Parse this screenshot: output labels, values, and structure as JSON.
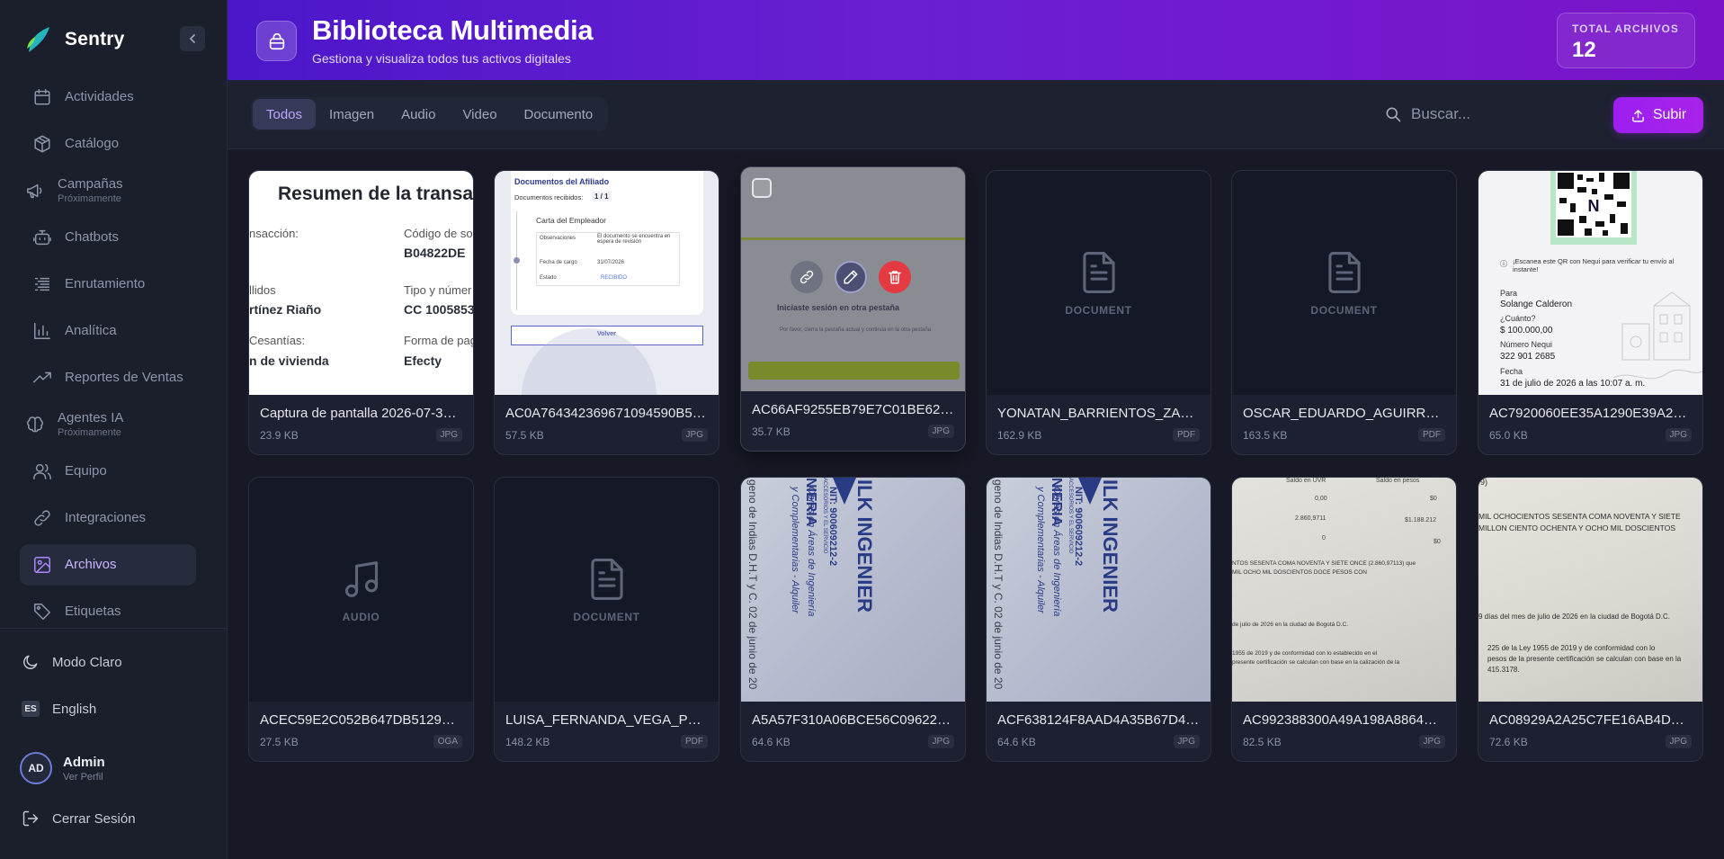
{
  "brand": {
    "name": "Sentry"
  },
  "sidebar": {
    "items": [
      {
        "label": "Actividades",
        "sub": "",
        "icon": "calendar-icon"
      },
      {
        "label": "Catálogo",
        "sub": "",
        "icon": "box-icon"
      },
      {
        "label": "Campañas",
        "sub": "Próximamente",
        "icon": "megaphone-icon"
      },
      {
        "label": "Chatbots",
        "sub": "",
        "icon": "bot-icon"
      },
      {
        "label": "Enrutamiento",
        "sub": "",
        "icon": "list-icon"
      },
      {
        "label": "Analítica",
        "sub": "",
        "icon": "bar-chart-icon"
      },
      {
        "label": "Reportes de Ventas",
        "sub": "",
        "icon": "trending-up-icon"
      },
      {
        "label": "Agentes IA",
        "sub": "Próximamente",
        "icon": "brain-icon"
      },
      {
        "label": "Equipo",
        "sub": "",
        "icon": "users-icon"
      },
      {
        "label": "Integraciones",
        "sub": "",
        "icon": "link-icon"
      },
      {
        "label": "Archivos",
        "sub": "",
        "icon": "image-icon"
      },
      {
        "label": "Etiquetas",
        "sub": "",
        "icon": "tag-icon"
      }
    ],
    "theme_label": "Modo Claro",
    "language_code": "ES",
    "language_label": "English",
    "user": {
      "initials": "AD",
      "name": "Admin",
      "sub": "Ver Perfil"
    },
    "logout_label": "Cerrar Sesión"
  },
  "header": {
    "title": "Biblioteca Multimedia",
    "subtitle": "Gestiona y visualiza todos tus activos digitales",
    "total_label": "TOTAL ARCHIVOS",
    "total_value": "12"
  },
  "toolbar": {
    "tabs": [
      "Todos",
      "Imagen",
      "Audio",
      "Video",
      "Documento"
    ],
    "active_tab": "Todos",
    "search_placeholder": "Buscar...",
    "upload_label": "Subir"
  },
  "files": [
    {
      "name": "Captura de pantalla 2026-07-3…",
      "size": "23.9 KB",
      "ext": "JPG",
      "kind": "image"
    },
    {
      "name": "AC0A764342369671094590B5…",
      "size": "57.5 KB",
      "ext": "JPG",
      "kind": "image"
    },
    {
      "name": "AC66AF9255EB79E7C01BE622…",
      "size": "35.7 KB",
      "ext": "JPG",
      "kind": "image"
    },
    {
      "name": "YONATAN_BARRIENTOS_ZAPA…",
      "size": "162.9 KB",
      "ext": "PDF",
      "kind": "document",
      "placeholder": "DOCUMENT"
    },
    {
      "name": "OSCAR_EDUARDO_AGUIRRE_…",
      "size": "163.5 KB",
      "ext": "PDF",
      "kind": "document",
      "placeholder": "DOCUMENT"
    },
    {
      "name": "AC7920060EE35A1290E39A2B…",
      "size": "65.0 KB",
      "ext": "JPG",
      "kind": "image"
    },
    {
      "name": "ACEC59E2C052B647DB51292E…",
      "size": "27.5 KB",
      "ext": "OGA",
      "kind": "audio",
      "placeholder": "AUDIO"
    },
    {
      "name": "LUISA_FERNANDA_VEGA_POR…",
      "size": "148.2 KB",
      "ext": "PDF",
      "kind": "document",
      "placeholder": "DOCUMENT"
    },
    {
      "name": "A5A57F310A06BCE56C09622A…",
      "size": "64.6 KB",
      "ext": "JPG",
      "kind": "image"
    },
    {
      "name": "ACF638124F8AAD4A35B67D48…",
      "size": "64.6 KB",
      "ext": "JPG",
      "kind": "image"
    },
    {
      "name": "AC992388300A49A198A8864E…",
      "size": "82.5 KB",
      "ext": "JPG",
      "kind": "image"
    },
    {
      "name": "AC08929A2A25C7FE16AB4D0F…",
      "size": "72.6 KB",
      "ext": "JPG",
      "kind": "image"
    }
  ],
  "thumbs": {
    "receipt": {
      "title": "Resumen de la transacc",
      "c1": [
        "nsacción:",
        "llidos",
        "rtínez Riaño",
        "Cesantías:",
        "n de vivienda"
      ],
      "c2": [
        "Código de so",
        "B04822DE",
        "Tipo y númer",
        "CC 1005853",
        "Forma de pag",
        "Efecty"
      ]
    },
    "affiliate": {
      "title": "Documentos del Afiliado",
      "received_label": "Documentos recibidos:",
      "received_value": "1 / 1",
      "card_title": "Carta del Empleador",
      "rows": [
        [
          "Observaciones",
          "El documento se encuentra en espera de revisión"
        ],
        [
          "Fecha de cargo",
          "31/07/2026"
        ],
        [
          "Estado",
          "RECIBIDO"
        ]
      ],
      "button": "Volver"
    },
    "session": {
      "title": "Iniciaste sesión en otra pestaña",
      "body": "Por favor, cierra la pestaña actual y continúa en la otra pestaña"
    },
    "nequi": {
      "scan_text": "¡Escanea este QR con Nequi para verificar tu envío al instante!",
      "para_label": "Para",
      "para_value": "Solange Calderon",
      "cuanto_label": "¿Cuánto?",
      "cuanto_value": "$ 100.000,00",
      "numero_label": "Número Nequi",
      "numero_value": "322 901 2685",
      "fecha_label": "Fecha",
      "fecha_value": "31 de julio de 2026 a las 10:07 a. m."
    },
    "sign": {
      "top": "geno de Indias D.H.T y C. 02 de junio de 20",
      "brand": "ILK INGENIER",
      "nit": "NIT: 900609212-2",
      "line1": "Obras en Áreas de Ingeniería",
      "line2": "y Complementarias - Alquiler",
      "side": "NIERIA",
      "side2": "ACCESORIOS Y EL SERVICIO"
    },
    "cert1": {
      "h1": "Saldo en UVR",
      "h2": "Saldo en pesos",
      "n1": "0,00",
      "n2": "$0",
      "n3": "2.860,9711",
      "n4": "$1.188.212",
      "n5": "0",
      "n6": "$0",
      "l1": "NTOS SESENTA COMA NOVENTA Y SIETE ONCE (2.860,97113) que",
      "l2": "MIL OCHO MIL DOSCIENTOS DOCE PESOS CON",
      "l3": "de julio de 2026 en la ciudad de Bogotá D.C.",
      "l4": "1955 de 2019 y de conformidad con lo establecido en el",
      "l5": "presente certificación se calculan con base en la calización de la"
    },
    "cert2": {
      "l0": "9)",
      "l1": "MIL OCHOCIENTOS SESENTA COMA NOVENTA Y SIETE",
      "l2": "MILLON CIENTO OCHENTA Y OCHO MIL DOSCIENTOS",
      "l3": "9 días del mes de julio de 2026 en la ciudad de Bogotá D.C.",
      "l4": "225 de la Ley 1955 de 2019 y de conformidad con lo",
      "l5": "pesos de la presente certificación se calculan con base en la",
      "l6": "415.3178."
    }
  }
}
